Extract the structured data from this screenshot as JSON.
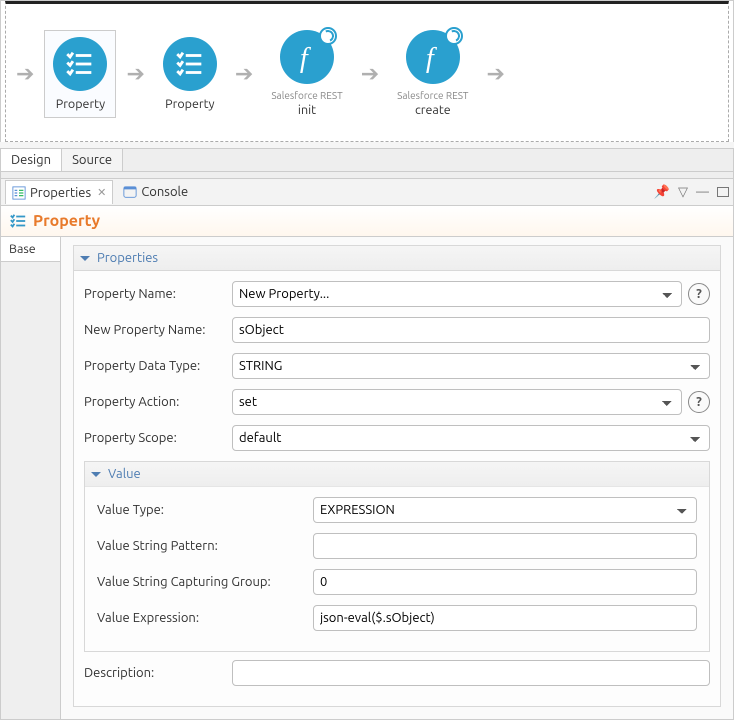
{
  "flow": {
    "nodes": [
      {
        "sublabel": "",
        "label": "Property",
        "selected": true,
        "type": "list"
      },
      {
        "sublabel": "",
        "label": "Property",
        "selected": false,
        "type": "list"
      },
      {
        "sublabel": "Salesforce REST",
        "label": "init",
        "selected": false,
        "type": "function"
      },
      {
        "sublabel": "Salesforce REST",
        "label": "create",
        "selected": false,
        "type": "function"
      }
    ]
  },
  "editorTabs": {
    "design": "Design",
    "source": "Source"
  },
  "views": {
    "properties": "Properties",
    "console": "Console"
  },
  "header": {
    "title": "Property"
  },
  "sidebar": {
    "base": "Base"
  },
  "props": {
    "sectionTitle": "Properties",
    "propertyName": {
      "label": "Property Name:",
      "value": "New Property..."
    },
    "newPropertyName": {
      "label": "New Property Name:",
      "value": "sObject"
    },
    "propertyDataType": {
      "label": "Property Data Type:",
      "value": "STRING"
    },
    "propertyAction": {
      "label": "Property Action:",
      "value": "set"
    },
    "propertyScope": {
      "label": "Property Scope:",
      "value": "default"
    },
    "valueSection": {
      "title": "Value",
      "valueType": {
        "label": "Value Type:",
        "value": "EXPRESSION"
      },
      "valueStringPattern": {
        "label": "Value String Pattern:",
        "value": ""
      },
      "valueStringCapturingGroup": {
        "label": "Value String Capturing Group:",
        "value": "0"
      },
      "valueExpression": {
        "label": "Value Expression:",
        "value": "json-eval($.sObject)"
      }
    },
    "description": {
      "label": "Description:",
      "value": ""
    },
    "help": "?"
  }
}
